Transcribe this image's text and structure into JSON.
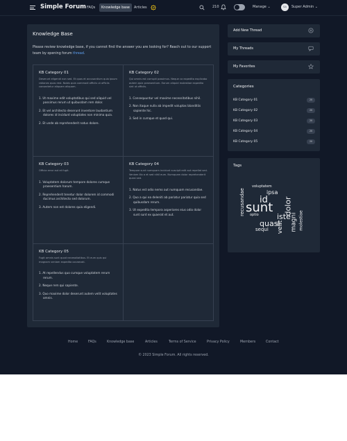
{
  "nav": {
    "brand": "Simple Forum",
    "links": [
      "FAQs",
      "Knowledge base",
      "Articles"
    ],
    "count": "210",
    "manage": "Manage",
    "user_initials": "SA",
    "user": "Super Admin"
  },
  "kb": {
    "title": "Knowledge Base",
    "intro_text": "Please review knowledge base, if you cannot find the answer you are looking for? Reach out to our support team by opening forum",
    "intro_link": "thread",
    "intro_end": ".",
    "categories": [
      {
        "title": "KB Category 01",
        "desc": "Deserunt eligendi non sed. Et quos et accusantium quia ipsum rationes quos rest. Nobis quia commodi officiis ut officiis consectetur aliquam aliquam.",
        "items": [
          "1. Ut maxime edit voluptatibus qui sed aliquid vel possimus rerum ut quibusdam rem dolor.",
          "2. Et vel architecto deserunt inventore laudantium dolores id incidunt voluptates non minima quia.",
          "2. Et unde ab reprehenderit natus dolore."
        ]
      },
      {
        "title": "KB Category 02",
        "desc": "Qui omnis est corrupti possimus. Neque ca expedita explicabo autem quia praesentium. Earum aliquid molestiae expedita sint ut officiis.",
        "items": [
          "1. Consequuntur vel maxime necessitatibus nihil.",
          "2. Non itaque nulla ab impedit voluptas blanditiis sapiente hic.",
          "3. Sed in cumque et quod qui."
        ]
      },
      {
        "title": "KB Category 03",
        "desc": "Officia error aut et fugit.",
        "items": [
          "1. Voluptatem dolorum tempore dolores cumque praesentium harum.",
          "2. Reprehenderit tenetur dolor dolorem id commodi ducimus architecto sed dolorum.",
          "3. Autem non est dolores quia eligendi."
        ]
      },
      {
        "title": "KB Category 04",
        "desc": "Tempore sunt numquam incidunt suscipit edit aut repellat sed. Veniam illo a et sed nihil eum. Numquam dolor reprehenderit quasi sed.",
        "items": [
          "1. Natus est odio nemo aut numquam recusandae.",
          "2. Quo a qui ea deleniti ab pariatur pariatur quia sed quibusdam rerum.",
          "3. Ut expedita tempora asperiores eius odio dolor sunt sunt ex quaerat et aut."
        ]
      },
      {
        "title": "KB Category 05",
        "desc": "Fugit omnis sunt quod necessitatibus. Et eum quis qui magnam veniam expedita occaecati.",
        "items": [
          "1. At repellendus quo cumque voluptatem rerum rerum.",
          "2. Neque rem qui sapiente.",
          "3. Quo maxime dolor deserunt autem velit voluptates omnis."
        ]
      }
    ]
  },
  "sidebar": {
    "add_thread": "Add New Thread",
    "my_threads": "My Threads",
    "my_favorites": "My Favorites",
    "categories_title": "Categories",
    "categories": [
      {
        "name": "KB Category 01",
        "count": "20"
      },
      {
        "name": "KB Category 02",
        "count": "20"
      },
      {
        "name": "KB Category 03",
        "count": "20"
      },
      {
        "name": "KB Category 04",
        "count": "20"
      },
      {
        "name": "KB Category 05",
        "count": "20"
      }
    ],
    "tags_title": "Tags",
    "tags": [
      "voluptatem",
      "recusandae",
      "ipsa",
      "id",
      "sunt",
      "dolor",
      "optio",
      "iste",
      "magni",
      "molestiae",
      "quasi",
      "velit",
      "sequi",
      "eum"
    ]
  },
  "footer": {
    "links": [
      "Home",
      "FAQs",
      "Knowledge base",
      "Articles",
      "Terms of Service",
      "Privacy Policy",
      "Members",
      "Contact"
    ],
    "copyright": "© 2023 Simple Forum. All rights reserved."
  },
  "colors": {
    "background": "#111827",
    "card": "#1f2937",
    "link": "#60a5fa"
  }
}
